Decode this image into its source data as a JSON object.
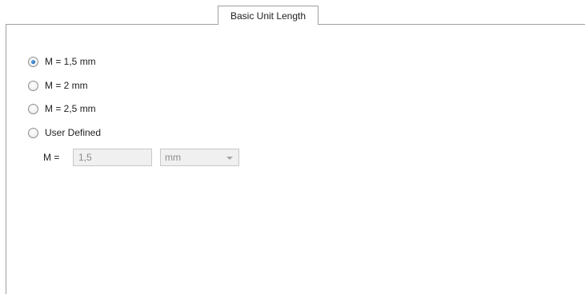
{
  "tab": {
    "label": "Basic Unit Length"
  },
  "options": [
    {
      "label": "M = 1,5 mm",
      "checked": true
    },
    {
      "label": "M = 2 mm",
      "checked": false
    },
    {
      "label": "M = 2,5 mm",
      "checked": false
    },
    {
      "label": "User Defined",
      "checked": false
    }
  ],
  "user_defined": {
    "label": "M =",
    "value": "1,5",
    "unit": "mm",
    "disabled": true
  },
  "colors": {
    "border": "#a0a0a0",
    "disabled_bg": "#f0f0f0",
    "disabled_text": "#8a8a8a",
    "radio_dot": "#1f6cc0"
  }
}
